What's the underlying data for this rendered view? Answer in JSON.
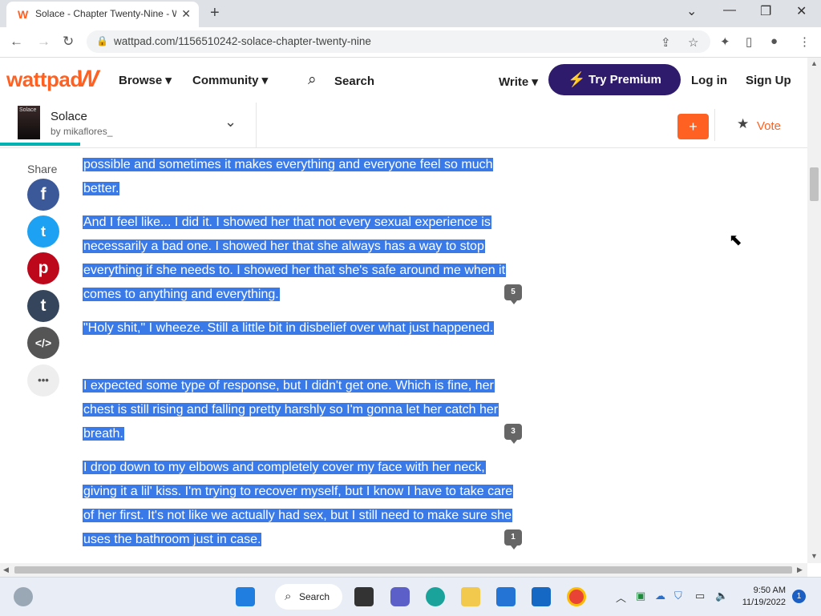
{
  "browser": {
    "tab_title": "Solace - Chapter Twenty-Nine - W",
    "tab_icon": "W",
    "url": "wattpad.com/1156510242-solace-chapter-twenty-nine"
  },
  "header": {
    "logo": "wattpad",
    "browse": "Browse ▾",
    "community": "Community ▾",
    "search": "Search",
    "write": "Write ▾",
    "premium": "Try Premium",
    "login": "Log in",
    "signup": "Sign Up"
  },
  "story": {
    "cover_text": "Solace",
    "title": "Solace",
    "author": "by mikaflores_",
    "add": "+",
    "vote": "Vote"
  },
  "share": {
    "label": "Share",
    "facebook": "f",
    "twitter": "t",
    "pinterest": "p",
    "tumblr": "t",
    "embed": "</>",
    "more": "•••"
  },
  "content": {
    "p1": "possible and sometimes it makes everything and everyone feel so much better.",
    "p2": "And I feel like... I did it. I showed her that not every sexual experience is necessarily a bad one. I showed her that she always has a way to stop everything if she needs to. I showed her that she's safe around me when it comes to anything and everything.",
    "p3": "\"Holy shit,\" I wheeze. Still a little bit in disbelief over  what just happened.",
    "p4": "I expected some type of response, but I didn't get one. Which is fine, her chest is still rising and falling pretty harshly so I'm gonna let her catch her breath.",
    "p5": "I drop down to my elbows and completely cover my face with her neck, giving it a lil' kiss. I'm trying to recover myself, but I know I have to take care of her first. It's not like we actually had sex, but I still need to make sure she uses the bathroom just in case.",
    "comments": [
      "5",
      "3",
      "1"
    ]
  },
  "taskbar": {
    "search": "Search",
    "time": "9:50 AM",
    "date": "11/19/2022",
    "notifications": "1"
  },
  "colors": {
    "brand": "#ff6122",
    "premium": "#2f1b6b",
    "highlight": "#3a7ae8"
  }
}
